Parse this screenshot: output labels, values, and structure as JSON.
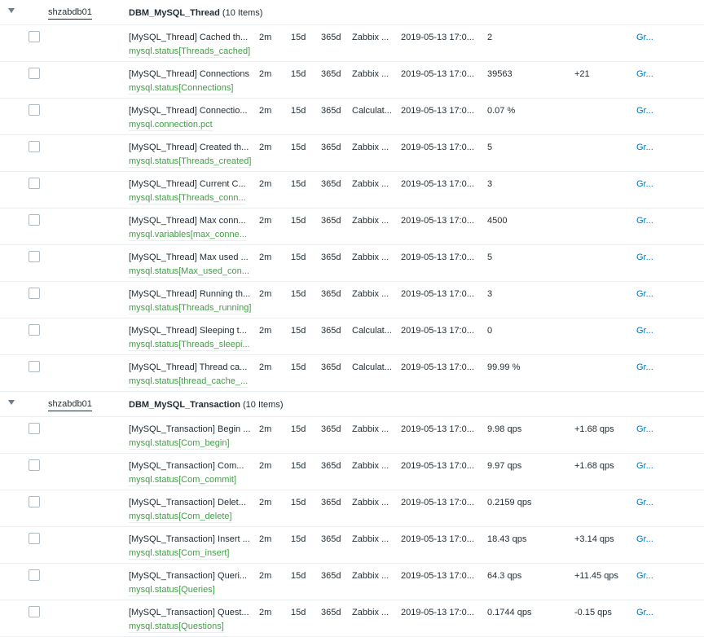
{
  "colors": {
    "key_green": "#429e47",
    "link_blue": "#0275b8",
    "text": "#1f2c33"
  },
  "groups": [
    {
      "host": "shzabdb01",
      "application": "DBM_MySQL_Thread",
      "count": "(10 Items)",
      "rows": [
        {
          "name": "[MySQL_Thread] Cached th...",
          "key": "mysql.status[Threads_cached]",
          "interval": "2m",
          "history": "15d",
          "trends": "365d",
          "type": "Zabbix ...",
          "lastcheck": "2019-05-13 17:0...",
          "lastvalue": "2",
          "change": "",
          "graph": "Gr..."
        },
        {
          "name": "[MySQL_Thread] Connections",
          "key": "mysql.status[Connections]",
          "interval": "2m",
          "history": "15d",
          "trends": "365d",
          "type": "Zabbix ...",
          "lastcheck": "2019-05-13 17:0...",
          "lastvalue": "39563",
          "change": "+21",
          "graph": "Gr..."
        },
        {
          "name": "[MySQL_Thread] Connectio...",
          "key": "mysql.connection.pct",
          "interval": "2m",
          "history": "15d",
          "trends": "365d",
          "type": "Calculat...",
          "lastcheck": "2019-05-13 17:0...",
          "lastvalue": "0.07 %",
          "change": "",
          "graph": "Gr..."
        },
        {
          "name": "[MySQL_Thread] Created th...",
          "key": "mysql.status[Threads_created]",
          "interval": "2m",
          "history": "15d",
          "trends": "365d",
          "type": "Zabbix ...",
          "lastcheck": "2019-05-13 17:0...",
          "lastvalue": "5",
          "change": "",
          "graph": "Gr..."
        },
        {
          "name": "[MySQL_Thread] Current C...",
          "key": "mysql.status[Threads_conn...",
          "interval": "2m",
          "history": "15d",
          "trends": "365d",
          "type": "Zabbix ...",
          "lastcheck": "2019-05-13 17:0...",
          "lastvalue": "3",
          "change": "",
          "graph": "Gr..."
        },
        {
          "name": "[MySQL_Thread] Max conn...",
          "key": "mysql.variables[max_conne...",
          "interval": "2m",
          "history": "15d",
          "trends": "365d",
          "type": "Zabbix ...",
          "lastcheck": "2019-05-13 17:0...",
          "lastvalue": "4500",
          "change": "",
          "graph": "Gr..."
        },
        {
          "name": "[MySQL_Thread] Max used ...",
          "key": "mysql.status[Max_used_con...",
          "interval": "2m",
          "history": "15d",
          "trends": "365d",
          "type": "Zabbix ...",
          "lastcheck": "2019-05-13 17:0...",
          "lastvalue": "5",
          "change": "",
          "graph": "Gr..."
        },
        {
          "name": "[MySQL_Thread] Running th...",
          "key": "mysql.status[Threads_running]",
          "interval": "2m",
          "history": "15d",
          "trends": "365d",
          "type": "Zabbix ...",
          "lastcheck": "2019-05-13 17:0...",
          "lastvalue": "3",
          "change": "",
          "graph": "Gr..."
        },
        {
          "name": "[MySQL_Thread] Sleeping t...",
          "key": "mysql.status[Threads_sleepi...",
          "interval": "2m",
          "history": "15d",
          "trends": "365d",
          "type": "Calculat...",
          "lastcheck": "2019-05-13 17:0...",
          "lastvalue": "0",
          "change": "",
          "graph": "Gr..."
        },
        {
          "name": "[MySQL_Thread] Thread ca...",
          "key": "mysql.status[thread_cache_...",
          "interval": "2m",
          "history": "15d",
          "trends": "365d",
          "type": "Calculat...",
          "lastcheck": "2019-05-13 17:0...",
          "lastvalue": "99.99 %",
          "change": "",
          "graph": "Gr..."
        }
      ]
    },
    {
      "host": "shzabdb01",
      "application": "DBM_MySQL_Transaction",
      "count": "(10 Items)",
      "rows": [
        {
          "name": "[MySQL_Transaction] Begin ...",
          "key": "mysql.status[Com_begin]",
          "interval": "2m",
          "history": "15d",
          "trends": "365d",
          "type": "Zabbix ...",
          "lastcheck": "2019-05-13 17:0...",
          "lastvalue": "9.98 qps",
          "change": "+1.68 qps",
          "graph": "Gr..."
        },
        {
          "name": "[MySQL_Transaction] Com...",
          "key": "mysql.status[Com_commit]",
          "interval": "2m",
          "history": "15d",
          "trends": "365d",
          "type": "Zabbix ...",
          "lastcheck": "2019-05-13 17:0...",
          "lastvalue": "9.97 qps",
          "change": "+1.68 qps",
          "graph": "Gr..."
        },
        {
          "name": "[MySQL_Transaction] Delet...",
          "key": "mysql.status[Com_delete]",
          "interval": "2m",
          "history": "15d",
          "trends": "365d",
          "type": "Zabbix ...",
          "lastcheck": "2019-05-13 17:0...",
          "lastvalue": "0.2159 qps",
          "change": "",
          "graph": "Gr..."
        },
        {
          "name": "[MySQL_Transaction] Insert ...",
          "key": "mysql.status[Com_insert]",
          "interval": "2m",
          "history": "15d",
          "trends": "365d",
          "type": "Zabbix ...",
          "lastcheck": "2019-05-13 17:0...",
          "lastvalue": "18.43 qps",
          "change": "+3.14 qps",
          "graph": "Gr..."
        },
        {
          "name": "[MySQL_Transaction] Queri...",
          "key": "mysql.status[Queries]",
          "interval": "2m",
          "history": "15d",
          "trends": "365d",
          "type": "Zabbix ...",
          "lastcheck": "2019-05-13 17:0...",
          "lastvalue": "64.3 qps",
          "change": "+11.45 qps",
          "graph": "Gr..."
        },
        {
          "name": "[MySQL_Transaction] Quest...",
          "key": "mysql.status[Questions]",
          "interval": "2m",
          "history": "15d",
          "trends": "365d",
          "type": "Zabbix ...",
          "lastcheck": "2019-05-13 17:0...",
          "lastvalue": "0.1744 qps",
          "change": "-0.15 qps",
          "graph": "Gr..."
        }
      ]
    }
  ]
}
